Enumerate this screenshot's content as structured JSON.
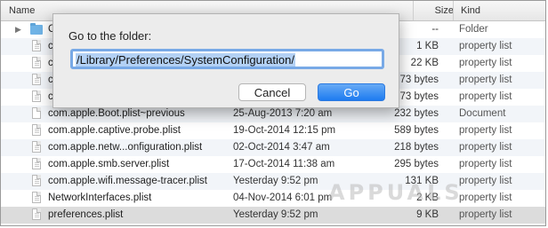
{
  "header": {
    "name": "Name",
    "size": "Size",
    "kind": "Kind"
  },
  "rows": [
    {
      "name": "C",
      "date": "",
      "size": "--",
      "kind": "Folder",
      "icon": "folder-icon"
    },
    {
      "name": "c",
      "date": "",
      "size": "1 KB",
      "kind": "property list",
      "icon": "plist-icon"
    },
    {
      "name": "c",
      "date": "",
      "size": "22 KB",
      "kind": "property list",
      "icon": "plist-icon"
    },
    {
      "name": "c",
      "date": "",
      "size": "73 bytes",
      "kind": "property list",
      "icon": "plist-icon"
    },
    {
      "name": "c",
      "date": "",
      "size": "73 bytes",
      "kind": "property list",
      "icon": "plist-icon"
    },
    {
      "name": "com.apple.Boot.plist~previous",
      "date": "25-Aug-2013 7:20 am",
      "size": "232 bytes",
      "kind": "Document",
      "icon": "document-icon"
    },
    {
      "name": "com.apple.captive.probe.plist",
      "date": "19-Oct-2014 12:15 pm",
      "size": "589 bytes",
      "kind": "property list",
      "icon": "plist-icon"
    },
    {
      "name": "com.apple.netw...onfiguration.plist",
      "date": "02-Oct-2014 3:47 am",
      "size": "218 bytes",
      "kind": "property list",
      "icon": "plist-icon"
    },
    {
      "name": "com.apple.smb.server.plist",
      "date": "17-Oct-2014 11:38 am",
      "size": "295 bytes",
      "kind": "property list",
      "icon": "plist-icon"
    },
    {
      "name": "com.apple.wifi.message-tracer.plist",
      "date": "Yesterday 9:52 pm",
      "size": "131 KB",
      "kind": "property list",
      "icon": "plist-icon"
    },
    {
      "name": "NetworkInterfaces.plist",
      "date": "04-Nov-2014 6:01 pm",
      "size": "2 KB",
      "kind": "property list",
      "icon": "plist-icon"
    },
    {
      "name": "preferences.plist",
      "date": "Yesterday 9:52 pm",
      "size": "9 KB",
      "kind": "property list",
      "icon": "plist-icon"
    }
  ],
  "dialog": {
    "title": "Go to the folder:",
    "path_value": "/Library/Preferences/SystemConfiguration/",
    "cancel_label": "Cancel",
    "go_label": "Go"
  },
  "watermark": {
    "text": "APPUALS"
  },
  "colors": {
    "accent": "#1e7bf0",
    "selection": "#b3d1f5",
    "focus_ring": "#78a9e6",
    "folder": "#6fb3e6"
  }
}
